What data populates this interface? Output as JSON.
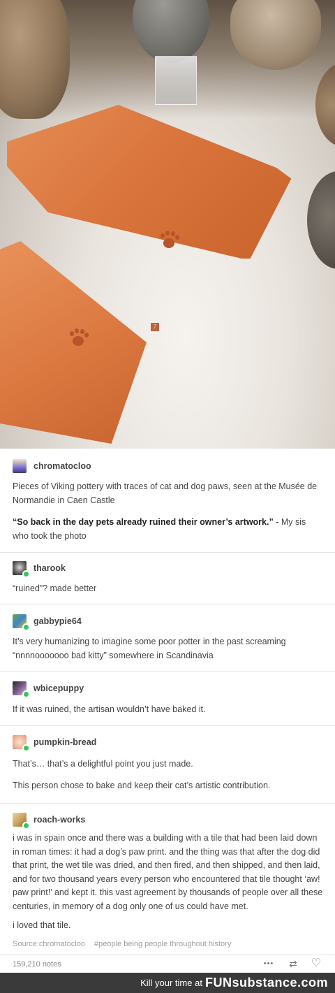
{
  "photo": {
    "label_chip": "7"
  },
  "post": {
    "op": {
      "username": "chromatocloo",
      "caption": "Pieces of Viking pottery with traces of cat and dog paws, seen at the Musée de Normandie in Caen Castle",
      "quote_bold": "“So back in the day pets already ruined their owner’s artwork.”",
      "quote_rest": " - My sis who took the photo"
    },
    "replies": [
      {
        "username": "tharook",
        "lines": [
          "“ruined”? made better"
        ]
      },
      {
        "username": "gabbypie64",
        "lines": [
          "It’s very humanizing to imagine some poor potter in the past screaming “nnnnooooooo bad kitty” somewhere in Scandinavia"
        ]
      },
      {
        "username": "wbicepuppy",
        "lines": [
          "If it was ruined, the artisan wouldn’t have baked it."
        ]
      },
      {
        "username": "pumpkin-bread",
        "lines": [
          "That’s… that’s a delightful point you just made.",
          "This person chose to bake and keep their cat’s artistic contribution."
        ]
      },
      {
        "username": "roach-works",
        "lines": [
          "i was in spain once and there was a building with a tile that had been laid down in roman times: it had a dog’s paw print. and the thing was that after the dog did that print, the wet tile was dried, and then fired, and then shipped, and then laid, and for two thousand years every person who encountered that tile thought ‘aw! paw print!’ and kept it. this vast agreement by thousands of people over all these centuries, in memory of a dog only one of us could have met.",
          "i loved that tile."
        ]
      }
    ],
    "footer": {
      "source": "Source:chromatocloo",
      "tag": "#people being people throughout history",
      "notes": "159,210 notes",
      "more_icon": "•••",
      "reblog_icon": "⇄",
      "like_icon": "♡"
    }
  },
  "branding": {
    "text": "Kill your time at",
    "logo": "FUNsubstance.com"
  }
}
